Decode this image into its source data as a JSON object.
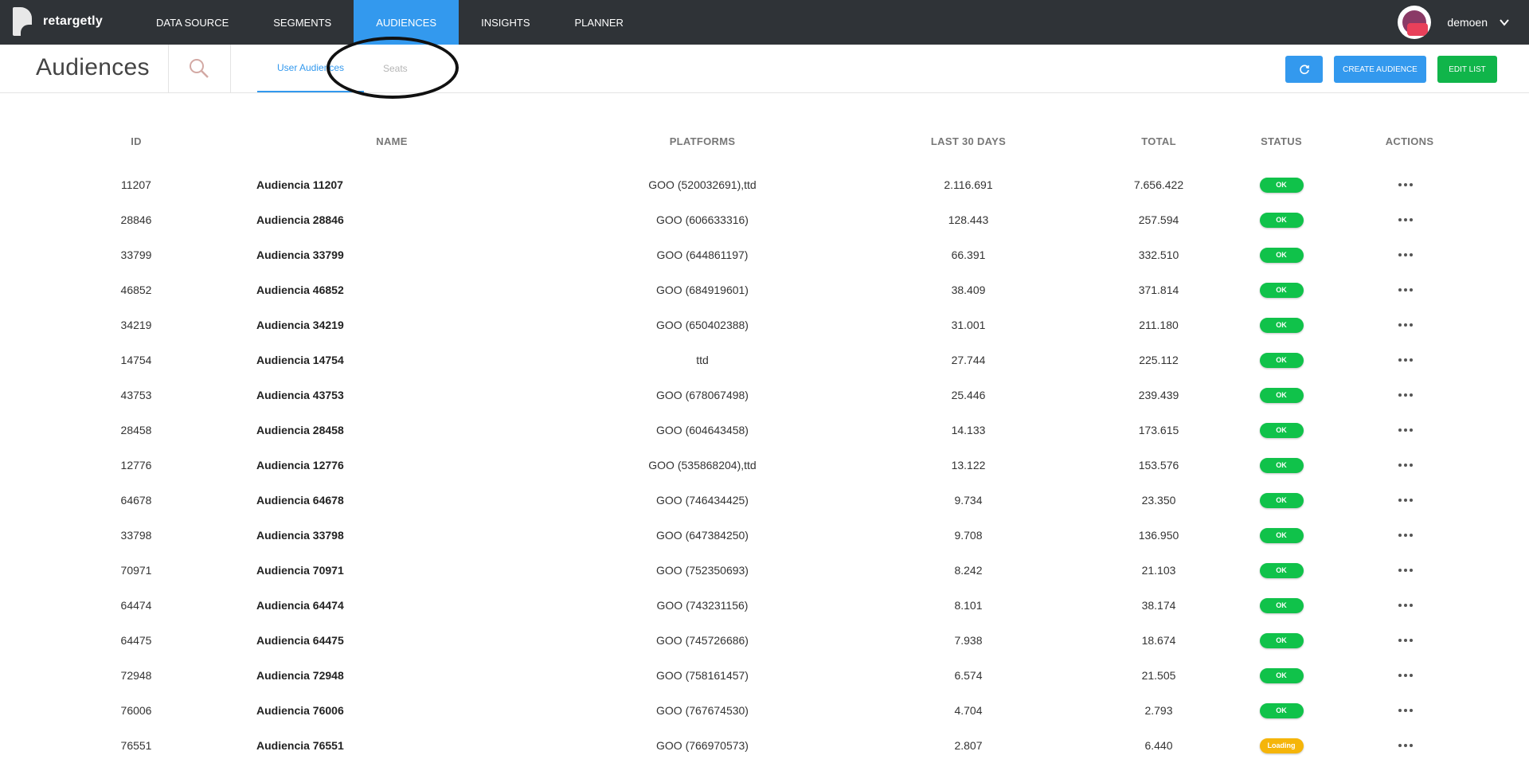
{
  "app": {
    "name": "retargetly"
  },
  "nav": {
    "items": [
      {
        "label": "DATA SOURCE"
      },
      {
        "label": "SEGMENTS"
      },
      {
        "label": "AUDIENCES"
      },
      {
        "label": "INSIGHTS"
      },
      {
        "label": "PLANNER"
      }
    ],
    "active": "AUDIENCES"
  },
  "user": {
    "name": "demoen"
  },
  "page": {
    "title": "Audiences"
  },
  "tabs": [
    {
      "label": "User Audiences",
      "active": true
    },
    {
      "label": "Seats",
      "active": false
    }
  ],
  "toolbar": {
    "create_label": "CREATE AUDIENCE",
    "edit_label": "EDIT LIST"
  },
  "table": {
    "headers": {
      "id": "ID",
      "name": "NAME",
      "platforms": "PLATFORMS",
      "last30": "LAST 30 DAYS",
      "total": "TOTAL",
      "status": "STATUS",
      "actions": "ACTIONS"
    },
    "rows": [
      {
        "id": "11207",
        "name": "Audiencia 11207",
        "platforms": "GOO (520032691),ttd",
        "last30": "2.116.691",
        "total": "7.656.422",
        "status": "OK"
      },
      {
        "id": "28846",
        "name": "Audiencia 28846",
        "platforms": "GOO (606633316)",
        "last30": "128.443",
        "total": "257.594",
        "status": "OK"
      },
      {
        "id": "33799",
        "name": "Audiencia 33799",
        "platforms": "GOO (644861197)",
        "last30": "66.391",
        "total": "332.510",
        "status": "OK"
      },
      {
        "id": "46852",
        "name": "Audiencia 46852",
        "platforms": "GOO (684919601)",
        "last30": "38.409",
        "total": "371.814",
        "status": "OK"
      },
      {
        "id": "34219",
        "name": "Audiencia 34219",
        "platforms": "GOO (650402388)",
        "last30": "31.001",
        "total": "211.180",
        "status": "OK"
      },
      {
        "id": "14754",
        "name": "Audiencia 14754",
        "platforms": "ttd",
        "last30": "27.744",
        "total": "225.112",
        "status": "OK"
      },
      {
        "id": "43753",
        "name": "Audiencia 43753",
        "platforms": "GOO (678067498)",
        "last30": "25.446",
        "total": "239.439",
        "status": "OK"
      },
      {
        "id": "28458",
        "name": "Audiencia 28458",
        "platforms": "GOO (604643458)",
        "last30": "14.133",
        "total": "173.615",
        "status": "OK"
      },
      {
        "id": "12776",
        "name": "Audiencia 12776",
        "platforms": "GOO (535868204),ttd",
        "last30": "13.122",
        "total": "153.576",
        "status": "OK"
      },
      {
        "id": "64678",
        "name": "Audiencia 64678",
        "platforms": "GOO (746434425)",
        "last30": "9.734",
        "total": "23.350",
        "status": "OK"
      },
      {
        "id": "33798",
        "name": "Audiencia 33798",
        "platforms": "GOO (647384250)",
        "last30": "9.708",
        "total": "136.950",
        "status": "OK"
      },
      {
        "id": "70971",
        "name": "Audiencia 70971",
        "platforms": "GOO (752350693)",
        "last30": "8.242",
        "total": "21.103",
        "status": "OK"
      },
      {
        "id": "64474",
        "name": "Audiencia 64474",
        "platforms": "GOO (743231156)",
        "last30": "8.101",
        "total": "38.174",
        "status": "OK"
      },
      {
        "id": "64475",
        "name": "Audiencia 64475",
        "platforms": "GOO (745726686)",
        "last30": "7.938",
        "total": "18.674",
        "status": "OK"
      },
      {
        "id": "72948",
        "name": "Audiencia 72948",
        "platforms": "GOO (758161457)",
        "last30": "6.574",
        "total": "21.505",
        "status": "OK"
      },
      {
        "id": "76006",
        "name": "Audiencia 76006",
        "platforms": "GOO (767674530)",
        "last30": "4.704",
        "total": "2.793",
        "status": "OK"
      },
      {
        "id": "76551",
        "name": "Audiencia 76551",
        "platforms": "GOO (766970573)",
        "last30": "2.807",
        "total": "6.440",
        "status": "Loading"
      }
    ]
  },
  "icons": {
    "search": "search-icon",
    "refresh": "refresh-icon",
    "chevron": "chevron-down-icon",
    "actions": "more-horizontal-icon"
  },
  "colors": {
    "topbar": "#2f3337",
    "accent": "#3399ee",
    "edit_button": "#10b54a",
    "status_ok": "#10c24a",
    "status_loading": "#f5b50a"
  }
}
